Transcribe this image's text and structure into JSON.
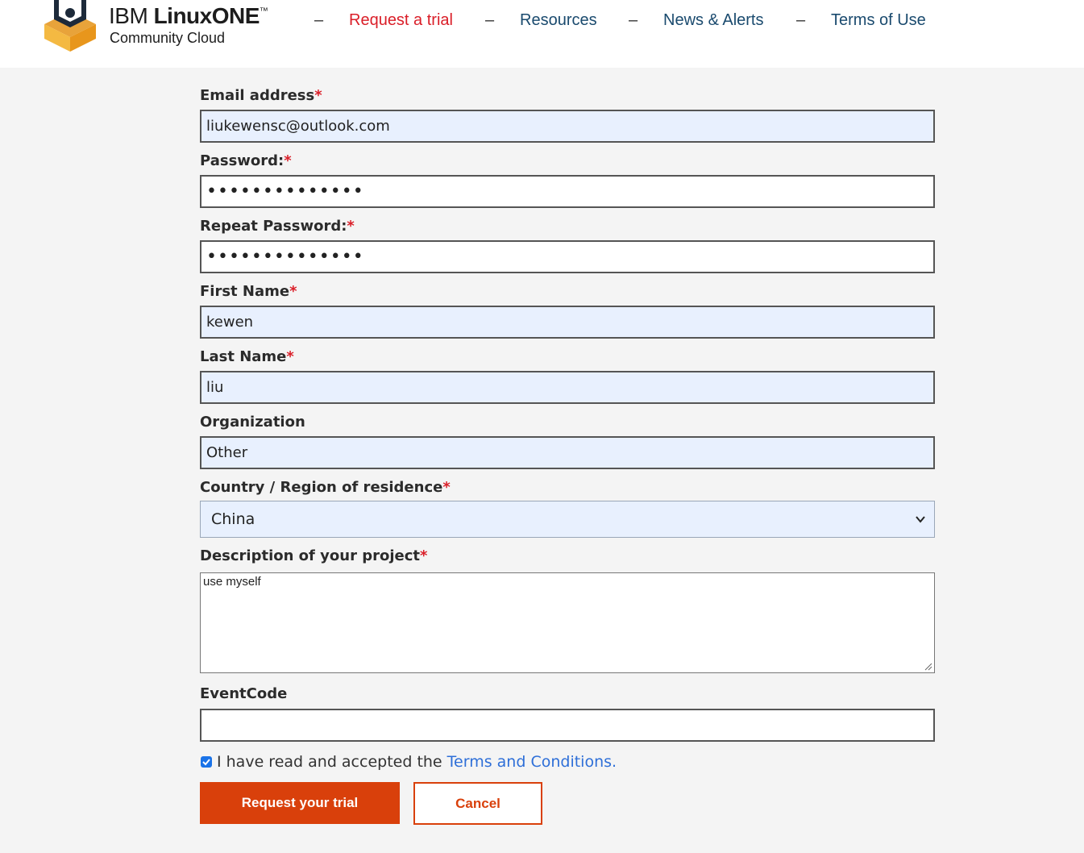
{
  "brand": {
    "name_prefix": "IBM ",
    "name_bold": "LinuxONE",
    "trademark": "™",
    "subtitle": "Community Cloud"
  },
  "nav": {
    "separator": "–",
    "items": [
      {
        "label": "Request a trial",
        "active": true
      },
      {
        "label": "Resources",
        "active": false
      },
      {
        "label": "News & Alerts",
        "active": false
      },
      {
        "label": "Terms of Use",
        "active": false
      }
    ]
  },
  "form": {
    "required_marker": "*",
    "email": {
      "label": "Email address",
      "value": "liukewensc@outlook.com"
    },
    "password": {
      "label": "Password:",
      "value": "••••••••••••••"
    },
    "repeat_password": {
      "label": "Repeat Password:",
      "value": "••••••••••••••"
    },
    "first_name": {
      "label": "First Name",
      "value": "kewen"
    },
    "last_name": {
      "label": "Last Name",
      "value": "liu"
    },
    "organization": {
      "label": "Organization",
      "value": "Other"
    },
    "country": {
      "label": "Country / Region of residence",
      "value": "China"
    },
    "description": {
      "label": "Description of your project",
      "value": "use myself"
    },
    "event_code": {
      "label": "EventCode",
      "value": ""
    },
    "terms": {
      "checked": true,
      "text": "I have read and accepted the ",
      "link": "Terms and Conditions."
    },
    "submit_label": "Request your trial",
    "cancel_label": "Cancel"
  },
  "colors": {
    "accent": "#d9400b",
    "nav_active": "#da1e28",
    "nav_link": "#1a4a6e",
    "autofill_bg": "#e8f0fe",
    "link": "#2e6fd8"
  }
}
